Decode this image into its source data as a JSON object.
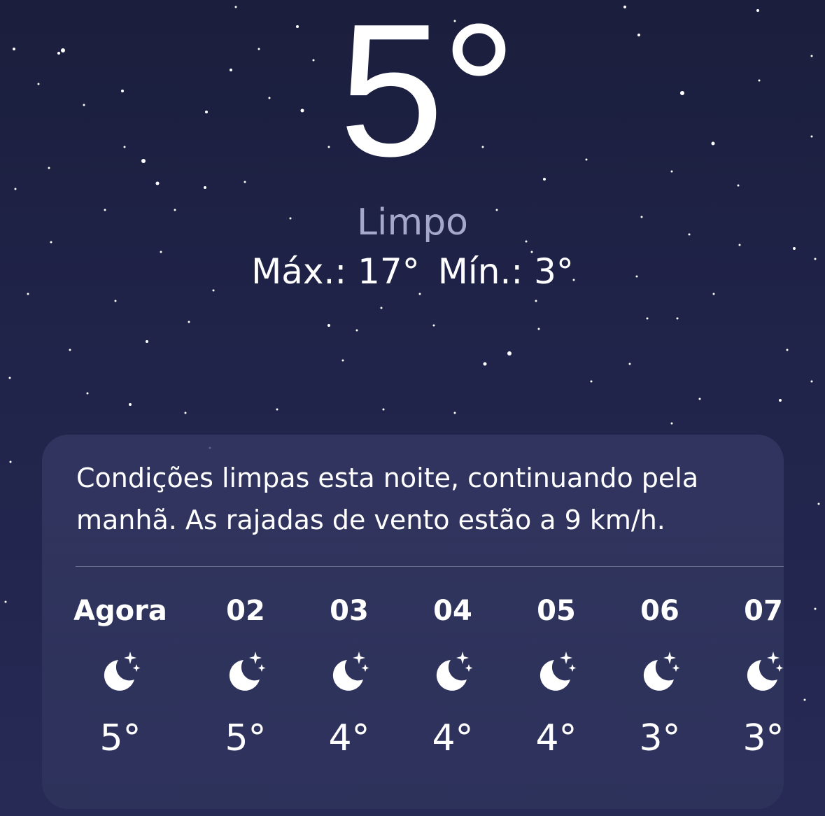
{
  "weather": {
    "current_temp": "5°",
    "condition": "Limpo",
    "high": "Máx.: 17°",
    "low": "Mín.: 3°"
  },
  "forecast_card": {
    "summary": "Condições limpas esta noite, continuando pela manhã. As rajadas de vento estão a 9 km/h.",
    "hours": [
      {
        "label": "Agora",
        "icon": "moon-stars-icon",
        "temp": "5°"
      },
      {
        "label": "02",
        "icon": "moon-stars-icon",
        "temp": "5°"
      },
      {
        "label": "03",
        "icon": "moon-stars-icon",
        "temp": "4°"
      },
      {
        "label": "04",
        "icon": "moon-stars-icon",
        "temp": "4°"
      },
      {
        "label": "05",
        "icon": "moon-stars-icon",
        "temp": "4°"
      },
      {
        "label": "06",
        "icon": "moon-stars-icon",
        "temp": "3°"
      },
      {
        "label": "07",
        "icon": "moon-stars-icon",
        "temp": "3°"
      }
    ]
  },
  "colors": {
    "sky_top": "#1b1e3c",
    "sky_bottom": "#262a55",
    "condition_text": "#a6a8cb",
    "card_bg": "#353963"
  }
}
